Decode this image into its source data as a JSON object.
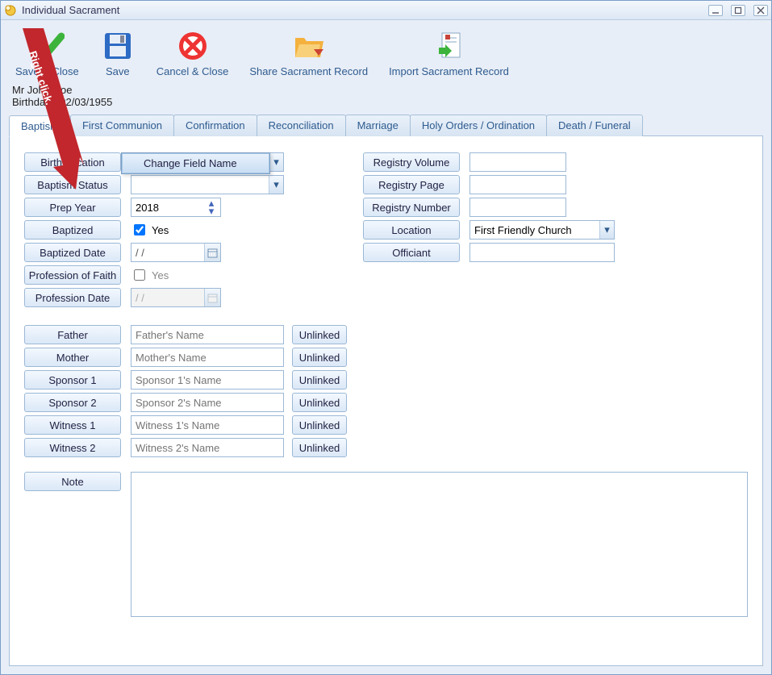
{
  "window": {
    "title": "Individual Sacrament"
  },
  "toolbar": {
    "save_close": "Save & Close",
    "save": "Save",
    "cancel_close": "Cancel & Close",
    "share": "Share Sacrament Record",
    "import": "Import Sacrament Record"
  },
  "person": {
    "name_line": "Mr John Doe",
    "birth_line": "Birthdate: 02/03/1955"
  },
  "tabs": {
    "baptism": "Baptism",
    "first_communion": "First Communion",
    "confirmation": "Confirmation",
    "reconciliation": "Reconciliation",
    "marriage": "Marriage",
    "holy_orders": "Holy Orders / Ordination",
    "death_funeral": "Death / Funeral"
  },
  "callout_text": "Right click.",
  "context_menu": {
    "change_field_name": "Change Field Name"
  },
  "left_fields": {
    "birth_location": {
      "label": "Birth Location",
      "value": ""
    },
    "baptism_status": {
      "label": "Baptism Status",
      "value": ""
    },
    "prep_year": {
      "label": "Prep Year",
      "value": "2018"
    },
    "baptized": {
      "label": "Baptized",
      "checked": true,
      "text": "Yes"
    },
    "baptized_date": {
      "label": "Baptized Date",
      "value": "  /  /"
    },
    "profession_of_faith": {
      "label": "Profession of Faith",
      "checked": false,
      "text": "Yes"
    },
    "profession_date": {
      "label": "Profession Date",
      "value": "  /  /"
    }
  },
  "right_fields": {
    "registry_volume": {
      "label": "Registry Volume",
      "value": ""
    },
    "registry_page": {
      "label": "Registry Page",
      "value": ""
    },
    "registry_number": {
      "label": "Registry Number",
      "value": ""
    },
    "location": {
      "label": "Location",
      "value": "First Friendly Church"
    },
    "officiant": {
      "label": "Officiant",
      "value": ""
    }
  },
  "people": {
    "father": {
      "label": "Father",
      "placeholder": "Father's Name",
      "link": "Unlinked"
    },
    "mother": {
      "label": "Mother",
      "placeholder": "Mother's Name",
      "link": "Unlinked"
    },
    "sponsor1": {
      "label": "Sponsor 1",
      "placeholder": "Sponsor 1's Name",
      "link": "Unlinked"
    },
    "sponsor2": {
      "label": "Sponsor 2",
      "placeholder": "Sponsor 2's Name",
      "link": "Unlinked"
    },
    "witness1": {
      "label": "Witness 1",
      "placeholder": "Witness 1's Name",
      "link": "Unlinked"
    },
    "witness2": {
      "label": "Witness 2",
      "placeholder": "Witness 2's Name",
      "link": "Unlinked"
    }
  },
  "note_label": "Note"
}
